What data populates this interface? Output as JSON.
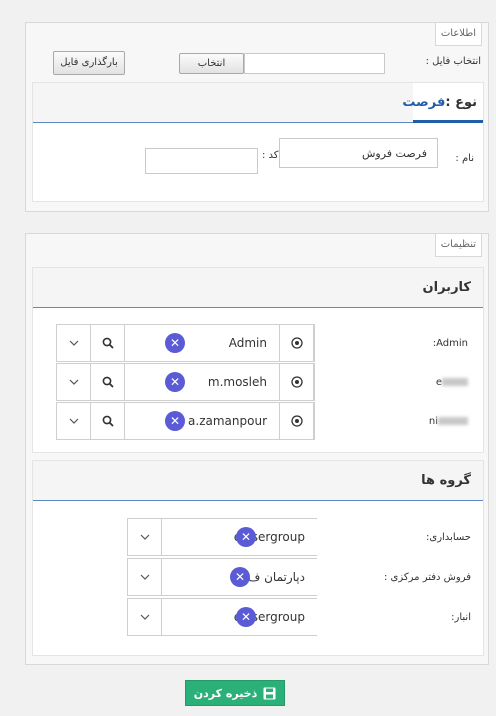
{
  "info_section": {
    "legend": "اطلاعات",
    "file_label": "انتخاب فایل :",
    "choose_button": "انتخاب",
    "file_value": "",
    "upload_button": "بارگذاری فایل",
    "type_tab": {
      "prefix": "نوع :",
      "value": "فرصت"
    },
    "name_label": "نام :",
    "name_value": "فرصت فروش",
    "code_label": "کد :",
    "code_value": ""
  },
  "settings_section": {
    "legend": "تنظیمات",
    "users_panel": {
      "title": "کاربران",
      "rows": [
        {
          "label": "Admin:",
          "value": "Admin",
          "label_blurred": false
        },
        {
          "label": "e",
          "value": "m.mosleh",
          "label_blurred": true
        },
        {
          "label": "ni",
          "value": "a.zamanpour",
          "label_blurred": true
        }
      ]
    },
    "groups_panel": {
      "title": "گروه ها",
      "rows": [
        {
          "label": "حسابداری:",
          "value": "ex serg​roup"
        },
        {
          "label": "فروش دفتر مرکزی :",
          "value": "دپارتمان ف"
        },
        {
          "label": "انبار:",
          "value": "ex serg​roup"
        }
      ]
    }
  },
  "save_button": "ذخیره کردن",
  "icons": {
    "clear": "close-icon",
    "search": "search-icon",
    "dropdown": "chevron-down-icon",
    "select": "radio-target-icon",
    "save": "floppy-disk-icon"
  },
  "colors": {
    "accent_blue": "#5d8ac0",
    "tab_blue": "#1f5fa8",
    "clear_badge": "#5b5bd6",
    "save_green": "#2cb07a"
  }
}
